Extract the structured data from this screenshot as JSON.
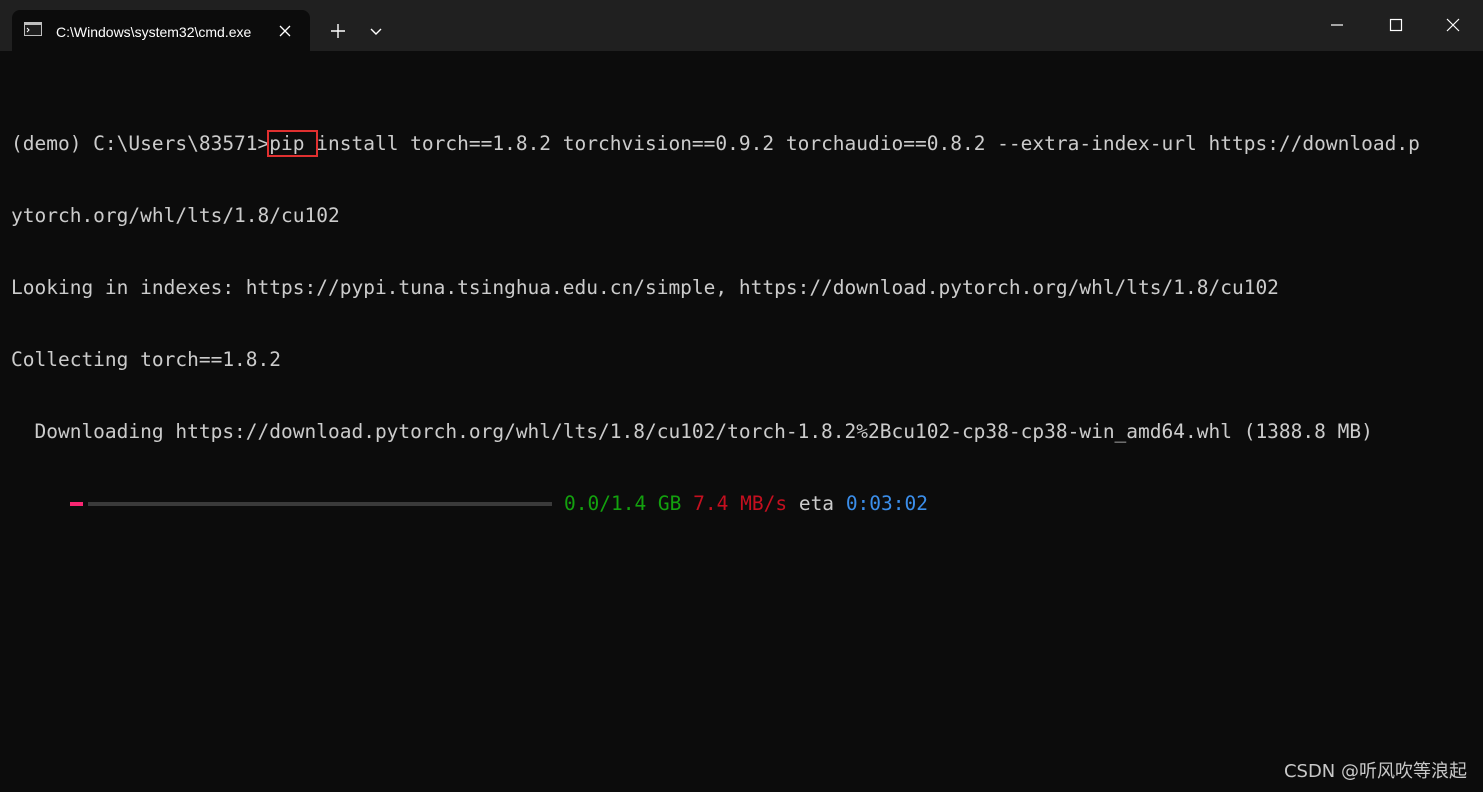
{
  "window": {
    "tab_title": "C:\\Windows\\system32\\cmd.exe",
    "tab_icon": "console-icon",
    "new_tab_icon": "plus-icon",
    "dropdown_icon": "chevron-down-icon",
    "minimize_icon": "minimize-icon",
    "maximize_icon": "maximize-icon",
    "close_icon": "close-icon"
  },
  "terminal": {
    "prompt": "(demo) C:\\Users\\83571>",
    "command_highlighted": "pip ",
    "command_rest": "install torch==1.8.2 torchvision==0.9.2 torchaudio==0.8.2 --extra-index-url https://download.p",
    "command_wrap": "ytorch.org/whl/lts/1.8/cu102",
    "looking_line": "Looking in indexes: https://pypi.tuna.tsinghua.edu.cn/simple, https://download.pytorch.org/whl/lts/1.8/cu102",
    "collecting_line": "Collecting torch==1.8.2",
    "downloading_line": "  Downloading https://download.pytorch.org/whl/lts/1.8/cu102/torch-1.8.2%2Bcu102-cp38-cp38-win_amd64.whl (1388.8 MB)",
    "progress": {
      "fraction": 0.0,
      "size": "0.0/1.4 GB",
      "speed": "7.4 MB/s",
      "eta_label": "eta",
      "eta_value": "0:03:02"
    },
    "colors": {
      "size": "#13a10e",
      "speed": "#c50f1f",
      "eta": "#3b8eea",
      "bar_fill": "#f92672",
      "highlight_box": "#e03030"
    }
  },
  "watermark": "CSDN @听风吹等浪起"
}
